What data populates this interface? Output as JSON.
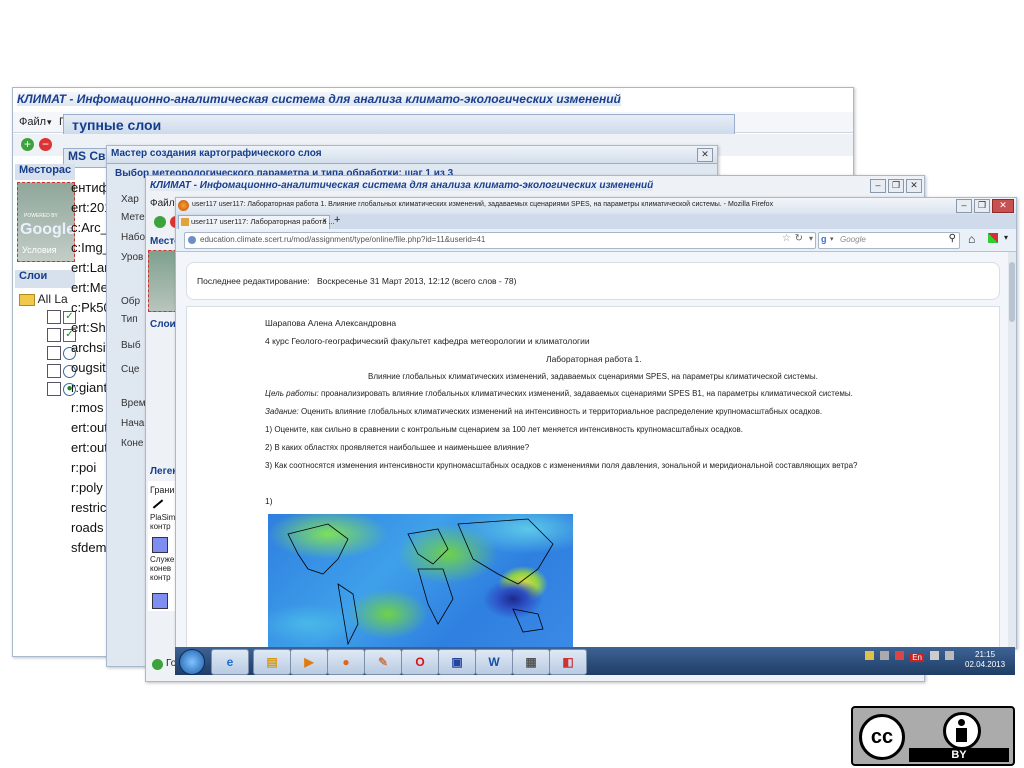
{
  "back_window": {
    "title": "КЛИМАТ - Инфомационно-аналитическая система для анализа климато-экологических изменений",
    "menu_file": "Файл",
    "menu_pr": "Пр",
    "dialog_header": "тупные слои",
    "ms_label": "MS Св",
    "panel_places": "Месторас",
    "google_powered": "POWERED BY",
    "google_logo": "Google",
    "google_terms": "Условия",
    "panel_layers": "Слои",
    "all_layers": "All La",
    "layer_names": [
      "ентиф",
      "ert:201",
      "c:Arc_",
      "c:Img_",
      "ert:Lan",
      "ert:Mea",
      "c:Pk50",
      "ert:Sha",
      "archsit",
      "ougsite",
      "r:giant",
      "r:mos",
      "ert:out_",
      "ert:out_",
      "r:poi",
      "r:poly",
      "restric",
      "roads",
      "sfdem"
    ]
  },
  "wizard": {
    "title": "Мастер создания картографического слоя",
    "subtitle": "Выбор метеорологического параметра и типа обработки: шаг 1 из 3",
    "labels": [
      "Хар",
      "Мете",
      "Набо",
      "Уров",
      "Обр",
      "Тип",
      "Выб",
      "Сце",
      "Врем",
      "Нача",
      "Коне"
    ]
  },
  "mid_window": {
    "title": "КЛИМАТ - Инфомационно-аналитическая система для анализа климато-экологических изменений",
    "menu_file": "Файл",
    "panel_places": "Местора",
    "panel_layers": "Слои",
    "legend_title": "Леген",
    "legend_items": [
      "Грани",
      "PlaSim контр",
      "Служе конев контр"
    ],
    "status_text": "Го"
  },
  "firefox": {
    "window_title": "user117 user117: Лабораторная работа 1. Влияние глобальных климатических изменений, задаваемых сценариями SPES, на параметры климатической системы. - Mozilla Firefox",
    "tab_label": "user117 user117: Лабораторная работа ...",
    "url": "education.climate.scert.ru/mod/assignment/type/online/file.php?id=11&userid=41",
    "search_placeholder": "Google",
    "last_edit_label": "Последнее редактирование:",
    "last_edit_value": "Воскресенье 31 Март 2013, 12:12 (всего слов - 78)",
    "doc": {
      "author": "Шарапова Алена Александровна",
      "course": "4 курс Геолого-географический факультет кафедра метеорологии и климатологии",
      "lab_title": "Лабораторная работа 1.",
      "lab_subtitle": "Влияние глобальных климатических изменений, задаваемых сценариями SPES, на параметры климатической системы.",
      "goal_label": "Цель работы:",
      "goal_text": "проанализировать влияние глобальных климатических изменений, задаваемых сценариями SPES B1, на параметры климатической системы.",
      "task_label": "Задание:",
      "task_text": "Оценить влияние глобальных климатических изменений на интенсивность и территориальное распределение крупномасштабных осадков.",
      "q1": "1) Оцените, как сильно в сравнении с контрольным сценарием за 100 лет меняется интенсивность крупномасштабных осадков.",
      "q2": "2) В каких областях проявляется наибольшее и наименьшее влияние?",
      "q3": "3) Как соотносятся изменения интенсивности крупномасштабных осадков с изменениями поля давления, зональной и меридиональной составляющих ветра?",
      "figure_label": "1)"
    }
  },
  "taskbar": {
    "clock_time": "21:15",
    "clock_date": "02.04.2013",
    "lang": "En",
    "apps": [
      "start-orb",
      "internet-explorer",
      "file-explorer",
      "media-player",
      "firefox",
      "paint",
      "opera",
      "save-disk",
      "word",
      "calculator",
      "presentation"
    ]
  },
  "license": {
    "cc": "cc",
    "by": "BY"
  },
  "colors": {
    "title_blue": "#1a3f8f",
    "taskbar": "#1f3d66",
    "map_blue": "#2f7fe0",
    "map_green": "#6fd24a"
  }
}
